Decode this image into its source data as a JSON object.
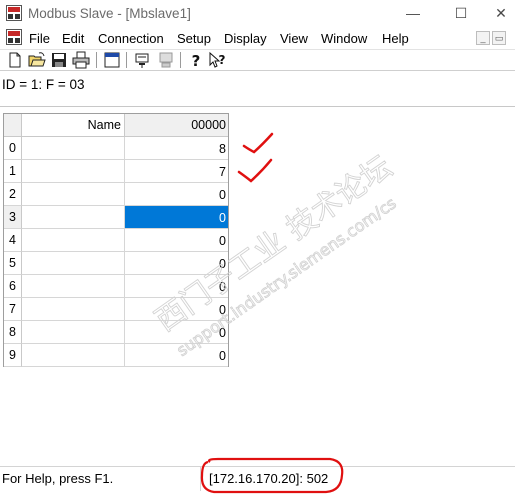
{
  "window": {
    "title": "Modbus Slave - [Mbslave1]",
    "min_glyph": "—",
    "max_glyph": "☐",
    "close_glyph": "✕"
  },
  "menu": {
    "items": [
      "File",
      "Edit",
      "Connection",
      "Setup",
      "Display",
      "View",
      "Window",
      "Help"
    ],
    "mdi_min": "_",
    "mdi_restore": "▭",
    "mdi_close": "×"
  },
  "toolbar": {
    "icons": [
      "new-icon",
      "open-icon",
      "save-icon",
      "print-icon",
      "window-icon",
      "connect-icon",
      "disconnect-icon",
      "help-icon",
      "context-help-icon"
    ]
  },
  "info": {
    "text": "ID = 1: F = 03"
  },
  "table": {
    "name_header": "Name",
    "address_header": "00000",
    "rows": [
      {
        "index": "0",
        "name": "",
        "value": "8"
      },
      {
        "index": "1",
        "name": "",
        "value": "7"
      },
      {
        "index": "2",
        "name": "",
        "value": "0"
      },
      {
        "index": "3",
        "name": "",
        "value": "0"
      },
      {
        "index": "4",
        "name": "",
        "value": "0"
      },
      {
        "index": "5",
        "name": "",
        "value": "0"
      },
      {
        "index": "6",
        "name": "",
        "value": "0"
      },
      {
        "index": "7",
        "name": "",
        "value": "0"
      },
      {
        "index": "8",
        "name": "",
        "value": "0"
      },
      {
        "index": "9",
        "name": "",
        "value": "0"
      }
    ],
    "selected_row": 3
  },
  "watermark": {
    "line1": "西门子工业",
    "line2": "技术论坛",
    "line3": "support.industry.siemens.com/cs"
  },
  "status": {
    "help": "For Help, press F1.",
    "connection": "[172.16.170.20]: 502"
  },
  "colors": {
    "selection": "#0078d7",
    "annotation": "#e01010",
    "app_icon": "#c62828"
  }
}
